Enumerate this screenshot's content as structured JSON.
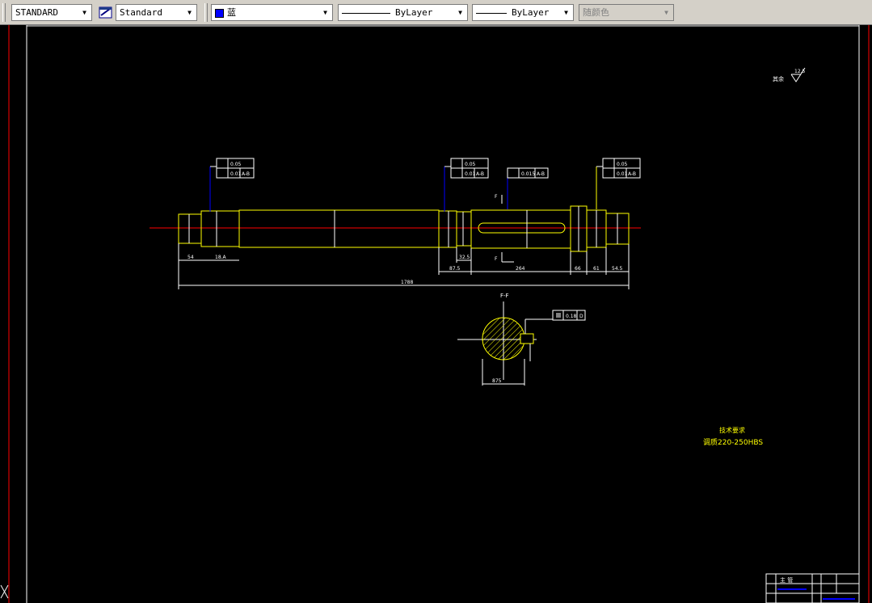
{
  "toolbar": {
    "text_style": "STANDARD",
    "dim_style": "Standard",
    "color": "蓝",
    "linetype": "ByLayer",
    "lineweight": "ByLayer",
    "plot_style": "随颜色"
  },
  "drawing": {
    "roughness_label": "其余",
    "roughness_value": "12.5",
    "tech_req_title": "技术要求",
    "tech_req_text": "调质220-250HBS",
    "section_label": "F-F",
    "section_mark": "F",
    "tol_1_a": "0.05",
    "tol_1_b": "0.01",
    "tol_1_c": "A-B",
    "tol_2_a": "0.05",
    "tol_2_b": "0.01",
    "tol_2_c": "A-B",
    "tol_3_a": "0.015",
    "tol_3_b": "A-B",
    "tol_4_a": "0.05",
    "tol_4_b": "0.01",
    "tol_4_c": "A-B",
    "sym_tol_a": "0.18",
    "sym_tol_b": "D",
    "dim_total": "1788",
    "dim_54": "54",
    "dim_180": "18.A",
    "dim_325": "32.5",
    "dim_875": "87.5",
    "dim_264": "264",
    "dim_66": "66",
    "dim_61": "61",
    "dim_545": "54.5",
    "dim_section": "875",
    "title_block_draw": "主 管"
  }
}
